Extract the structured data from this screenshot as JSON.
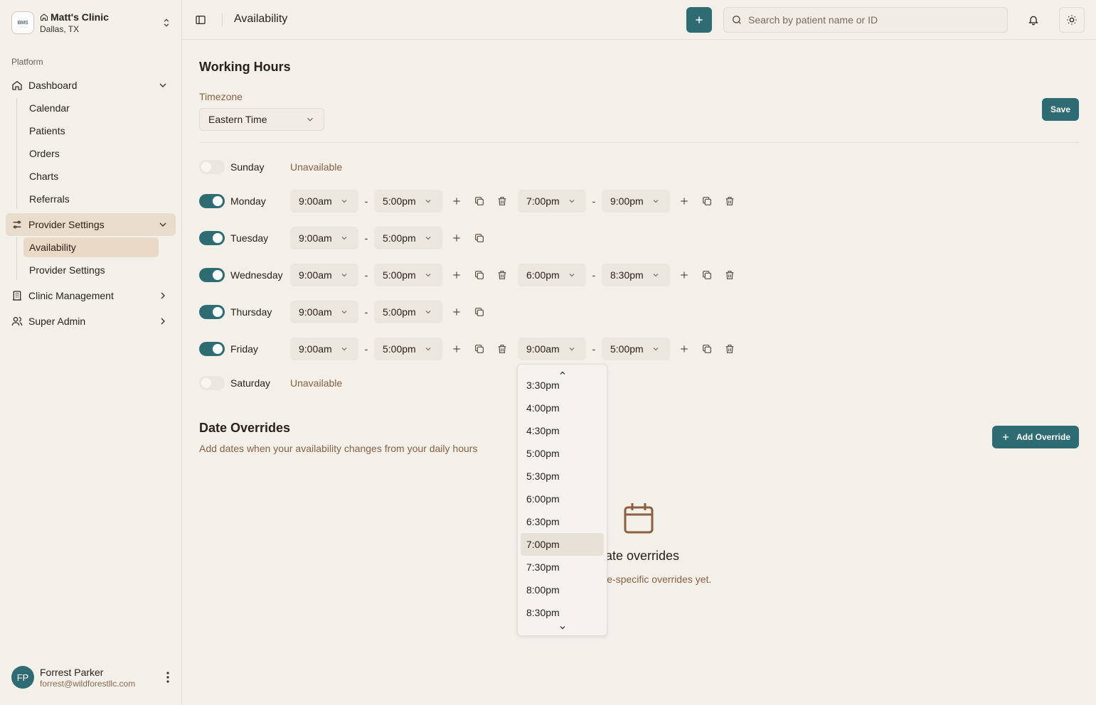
{
  "sidebar": {
    "clinic_name": "Matt's Clinic",
    "clinic_location": "Dallas, TX",
    "logo_text": "BMS",
    "section_label": "Platform",
    "dashboard": {
      "label": "Dashboard",
      "children": [
        "Calendar",
        "Patients",
        "Orders",
        "Charts",
        "Referrals"
      ]
    },
    "provider_settings": {
      "label": "Provider Settings",
      "children": [
        "Availability",
        "Provider Settings"
      ]
    },
    "clinic_management": "Clinic Management",
    "super_admin": "Super Admin",
    "user": {
      "initials": "FP",
      "name": "Forrest Parker",
      "email": "forrest@wildforestllc.com"
    }
  },
  "topbar": {
    "title": "Availability",
    "search_placeholder": "Search by patient name or ID"
  },
  "working_hours": {
    "title": "Working Hours",
    "timezone_label": "Timezone",
    "timezone_value": "Eastern Time",
    "save_label": "Save",
    "unavailable_label": "Unavailable",
    "days": [
      {
        "name": "Sunday",
        "enabled": false,
        "ranges": []
      },
      {
        "name": "Monday",
        "enabled": true,
        "ranges": [
          [
            "9:00am",
            "5:00pm"
          ],
          [
            "7:00pm",
            "9:00pm"
          ]
        ]
      },
      {
        "name": "Tuesday",
        "enabled": true,
        "ranges": [
          [
            "9:00am",
            "5:00pm"
          ]
        ]
      },
      {
        "name": "Wednesday",
        "enabled": true,
        "ranges": [
          [
            "9:00am",
            "5:00pm"
          ],
          [
            "6:00pm",
            "8:30pm"
          ]
        ]
      },
      {
        "name": "Thursday",
        "enabled": true,
        "ranges": [
          [
            "9:00am",
            "5:00pm"
          ]
        ]
      },
      {
        "name": "Friday",
        "enabled": true,
        "ranges": [
          [
            "9:00am",
            "5:00pm"
          ],
          [
            "9:00am",
            "5:00pm"
          ]
        ]
      },
      {
        "name": "Saturday",
        "enabled": false,
        "ranges": []
      }
    ]
  },
  "date_overrides": {
    "title": "Date Overrides",
    "subtitle": "Add dates when your availability changes from your daily hours",
    "add_label": "Add Override",
    "empty_title": "date overrides",
    "empty_subtitle": "d any date-specific overrides yet."
  },
  "time_dropdown": {
    "options": [
      "3:30pm",
      "4:00pm",
      "4:30pm",
      "5:00pm",
      "5:30pm",
      "6:00pm",
      "6:30pm",
      "7:00pm",
      "7:30pm",
      "8:00pm",
      "8:30pm"
    ],
    "highlighted": "7:00pm"
  },
  "colors": {
    "accent": "#2e6b73",
    "background": "#f3f0ea",
    "muted_text": "#8a6040",
    "selected_nav": "#ead9c6"
  }
}
